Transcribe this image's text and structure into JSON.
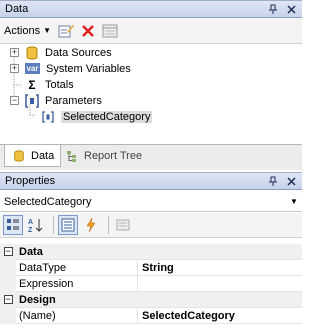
{
  "data_panel": {
    "title": "Data",
    "pin_glyph": "⬇",
    "close_glyph": "✕",
    "actions_label": "Actions",
    "tree": [
      {
        "label": "Data Sources",
        "icon": "database-icon"
      },
      {
        "label": "System Variables",
        "icon": "system-variables-icon",
        "icon_text": "var"
      },
      {
        "label": "Totals",
        "icon": "sigma-icon",
        "icon_text": "Σ"
      },
      {
        "label": "Parameters",
        "icon": "parameters-icon"
      },
      {
        "label": "SelectedCategory",
        "icon": "parameter-item-icon"
      }
    ],
    "tabs": [
      {
        "label": "Data"
      },
      {
        "label": "Report Tree"
      }
    ]
  },
  "properties_panel": {
    "title": "Properties",
    "pin_glyph": "⬇",
    "close_glyph": "✕",
    "selected_object": "SelectedCategory",
    "categories": [
      {
        "name": "Data",
        "props": [
          {
            "name": "DataType",
            "value": "String"
          },
          {
            "name": "Expression",
            "value": ""
          }
        ]
      },
      {
        "name": "Design",
        "props": [
          {
            "name": "(Name)",
            "value": "SelectedCategory"
          }
        ]
      }
    ]
  },
  "colors": {
    "header_bg": "#c6d2ea",
    "accent": "#316ac5",
    "delete_red": "#d22"
  }
}
